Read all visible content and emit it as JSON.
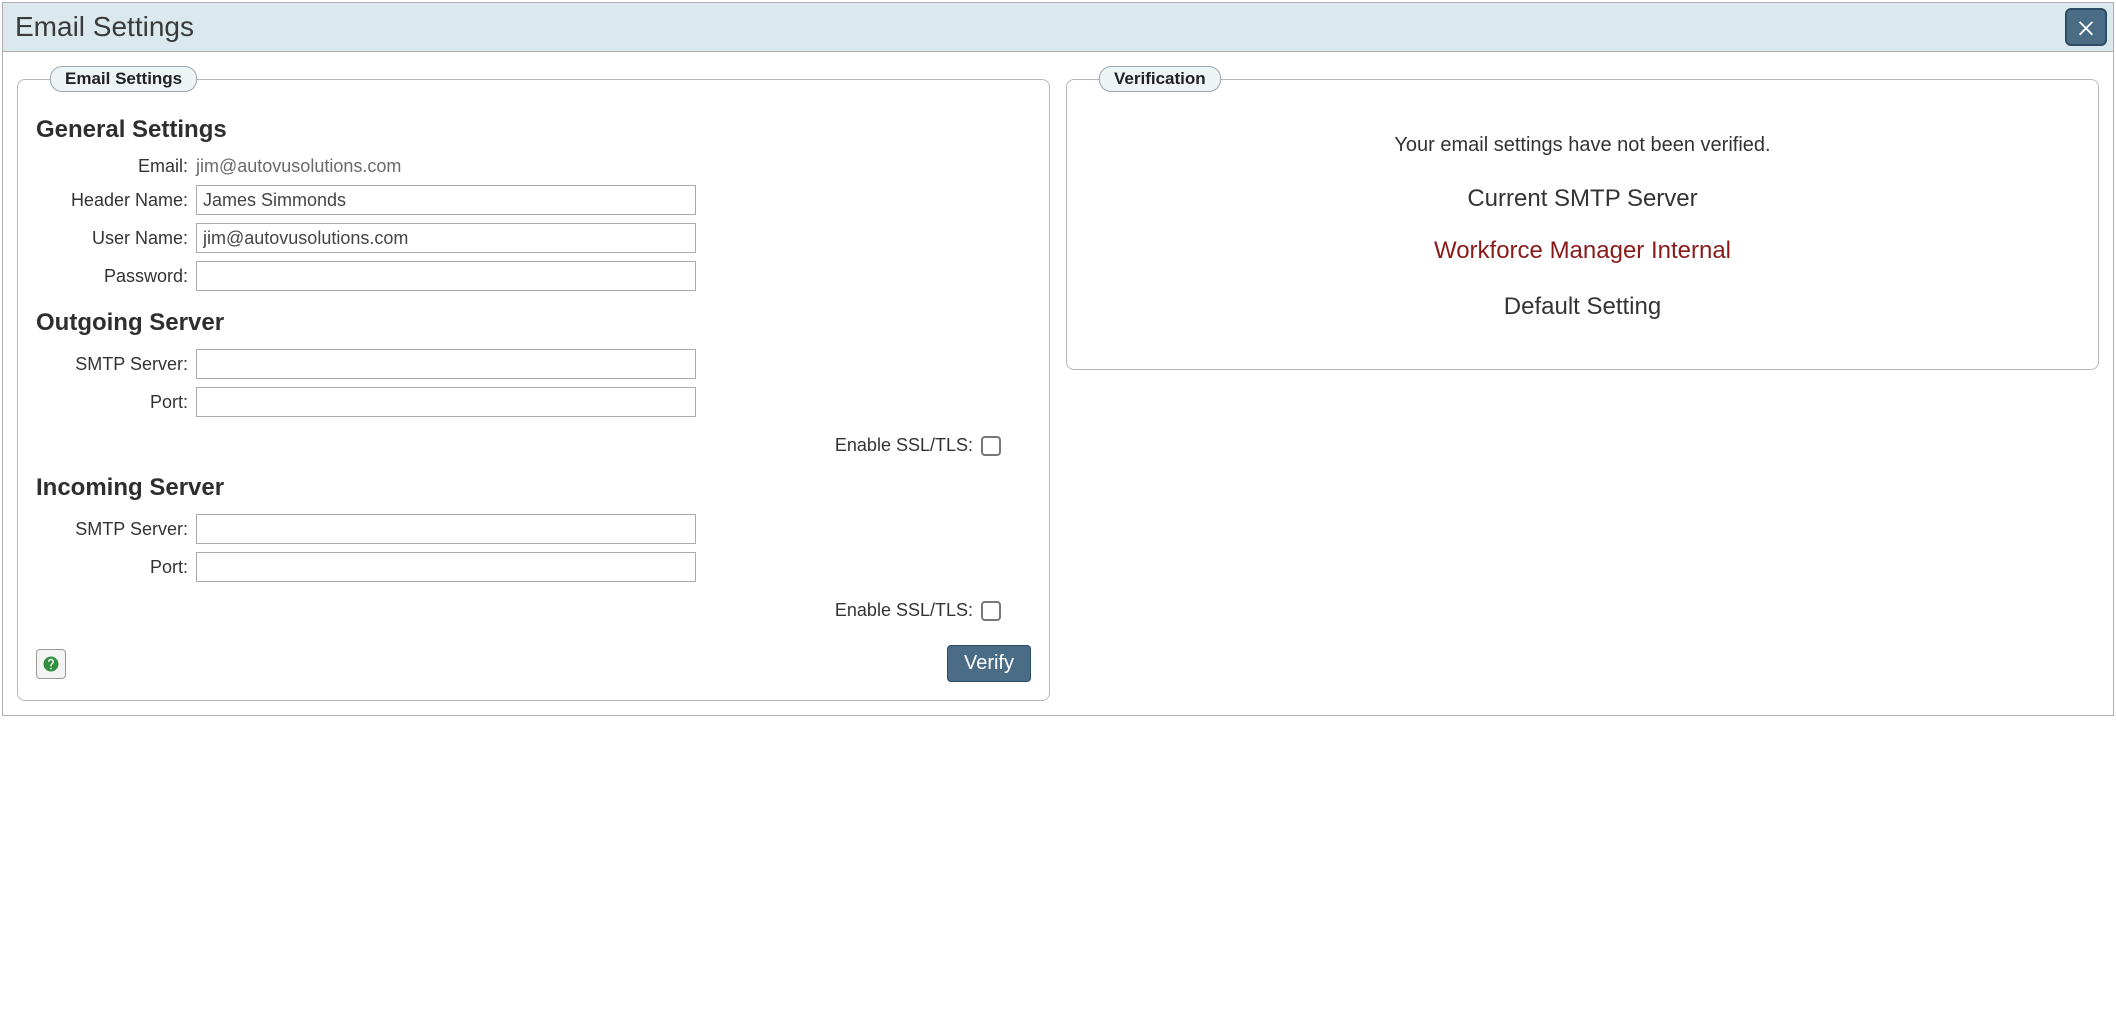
{
  "dialog": {
    "title": "Email Settings"
  },
  "left": {
    "legend": "Email Settings",
    "general": {
      "heading": "General Settings",
      "email_label": "Email:",
      "email_value": "jim@autovusolutions.com",
      "header_name_label": "Header Name:",
      "header_name_value": "James Simmonds",
      "user_name_label": "User Name:",
      "user_name_value": "jim@autovusolutions.com",
      "password_label": "Password:",
      "password_value": ""
    },
    "outgoing": {
      "heading": "Outgoing Server",
      "smtp_label": "SMTP Server:",
      "smtp_value": "",
      "port_label": "Port:",
      "port_value": "",
      "ssl_label": "Enable SSL/TLS:"
    },
    "incoming": {
      "heading": "Incoming Server",
      "smtp_label": "SMTP Server:",
      "smtp_value": "",
      "port_label": "Port:",
      "port_value": "",
      "ssl_label": "Enable SSL/TLS:"
    },
    "verify_button": "Verify"
  },
  "right": {
    "legend": "Verification",
    "message": "Your email settings have not been verified.",
    "current_label": "Current SMTP Server",
    "server_name": "Workforce Manager Internal",
    "default_label": "Default Setting"
  }
}
